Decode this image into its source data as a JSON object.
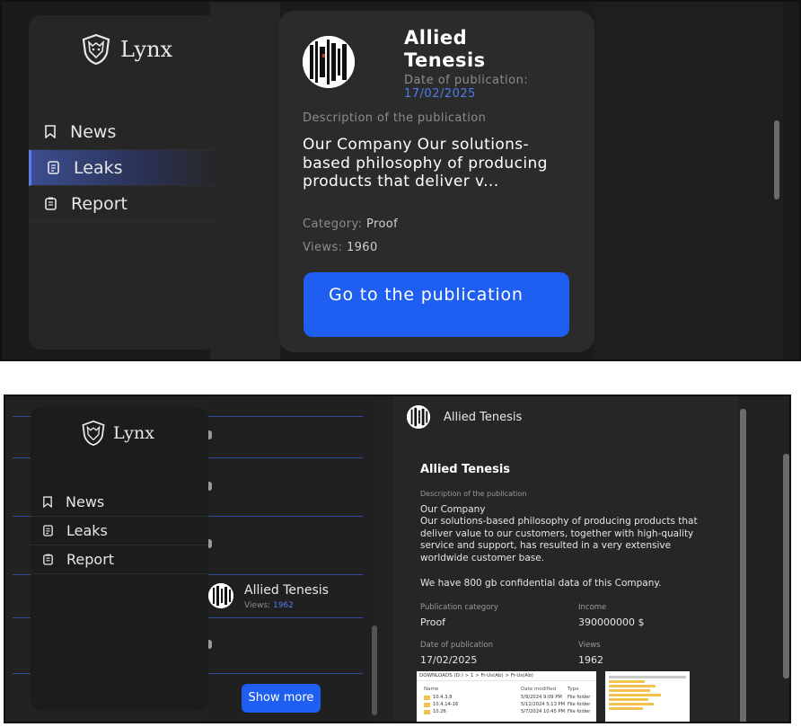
{
  "app": {
    "logo_text": "Lynx"
  },
  "sidebar": {
    "items": [
      {
        "label": "News",
        "icon": "bookmark-icon"
      },
      {
        "label": "Leaks",
        "icon": "document-icon"
      },
      {
        "label": "Report",
        "icon": "clipboard-icon"
      }
    ]
  },
  "card": {
    "company": "Allied Tenesis",
    "date_label": "Date of publication:",
    "date": "17/02/2025",
    "description_label": "Description of the publication",
    "description": "Our Company Our solutions-based philosophy of producing products that deliver v...",
    "category_label": "Category:",
    "category": "Proof",
    "views_label": "Views:",
    "views": "1960",
    "button": "Go to the publication"
  },
  "list": {
    "item_name": "Allied Tenesis",
    "item_views_label": "Views:",
    "item_views": "1962",
    "show_more": "Show more"
  },
  "detail": {
    "header_name": "Allied Tenesis",
    "title": "Allied Tenesis",
    "description_label": "Description of the publication",
    "description_line1": "Our Company",
    "description_body": "Our solutions-based philosophy of producing products that deliver value to our customers, together with high-quality service and support, has resulted in a very extensive worldwide customer base.",
    "extra": "We have 800 gb confidential data of this Company.",
    "category_label": "Publication category",
    "category": "Proof",
    "income_label": "Income",
    "income": "390000000 $",
    "date_label": "Date of publication",
    "date": "17/02/2025",
    "views_label": "Views",
    "views": "1962"
  },
  "explorer": {
    "path": "DOWNLOADS (D:) > 1 > Fr-Us(Ab) > Fr-Us(Ab)",
    "col_name": "Name",
    "col_date": "Date modified",
    "col_type": "Type",
    "rows": [
      {
        "name": "10.4.3.8",
        "date": "5/9/2024 9:09 PM",
        "type": "File folder"
      },
      {
        "name": "10.4.14-16",
        "date": "5/12/2024 5:13 PM",
        "type": "File folder"
      },
      {
        "name": "10.26",
        "date": "5/7/2024 10:45 PM",
        "type": "File folder"
      }
    ]
  },
  "colors": {
    "accent": "#1e5ef0",
    "link": "#4f7be8",
    "active_nav": "#3b4d8f"
  }
}
